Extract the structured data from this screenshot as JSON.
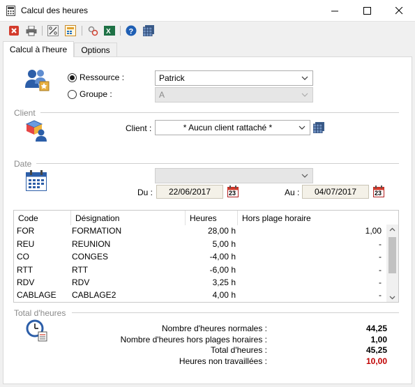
{
  "window": {
    "title": "Calcul des heures"
  },
  "toolbar": {
    "buttons": [
      {
        "icon": "close-red-icon"
      },
      {
        "icon": "print-icon"
      },
      {
        "icon": "percent-icon"
      },
      {
        "icon": "calculator-icon"
      },
      {
        "icon": "link-icon"
      },
      {
        "icon": "excel-icon"
      },
      {
        "icon": "help-icon"
      },
      {
        "icon": "grid-icon"
      }
    ]
  },
  "tabs": [
    {
      "label": "Calcul à l'heure",
      "active": true
    },
    {
      "label": "Options",
      "active": false
    }
  ],
  "resource": {
    "ressource_label": "Ressource :",
    "ressource_value": "Patrick",
    "groupe_label": "Groupe :",
    "groupe_value": "A",
    "selected": "ressource"
  },
  "client": {
    "section_label": "Client",
    "field_label": "Client :",
    "value": "* Aucun client rattaché *"
  },
  "date": {
    "section_label": "Date",
    "preset_value": "",
    "du_label": "Du :",
    "du_value": "22/06/2017",
    "au_label": "Au :",
    "au_value": "04/07/2017",
    "calendar_day": "23"
  },
  "table": {
    "columns": [
      "Code",
      "Désignation",
      "Heures",
      "Hors plage horaire"
    ],
    "rows": [
      {
        "code": "FOR",
        "designation": "FORMATION",
        "heures": "28,00 h",
        "hors_plage": "1,00"
      },
      {
        "code": "REU",
        "designation": "REUNION",
        "heures": "5,00 h",
        "hors_plage": "-"
      },
      {
        "code": "CO",
        "designation": "CONGES",
        "heures": "-4,00 h",
        "hors_plage": "-"
      },
      {
        "code": "RTT",
        "designation": "RTT",
        "heures": "-6,00 h",
        "hors_plage": "-"
      },
      {
        "code": "RDV",
        "designation": "RDV",
        "heures": "3,25 h",
        "hors_plage": "-"
      },
      {
        "code": "CABLAGE",
        "designation": "CABLAGE2",
        "heures": "4,00 h",
        "hors_plage": "-"
      }
    ]
  },
  "totals": {
    "section_label": "Total d'heures",
    "normales_label": "Nombre d'heures normales :",
    "normales_value": "44,25",
    "hors_plages_label": "Nombre d'heures hors plages horaires :",
    "hors_plages_value": "1,00",
    "total_label": "Total d'heures :",
    "total_value": "45,25",
    "non_travaillees_label": "Heures non travaillées :",
    "non_travaillees_value": "10,00",
    "non_travaillees_color": "#c00000"
  }
}
